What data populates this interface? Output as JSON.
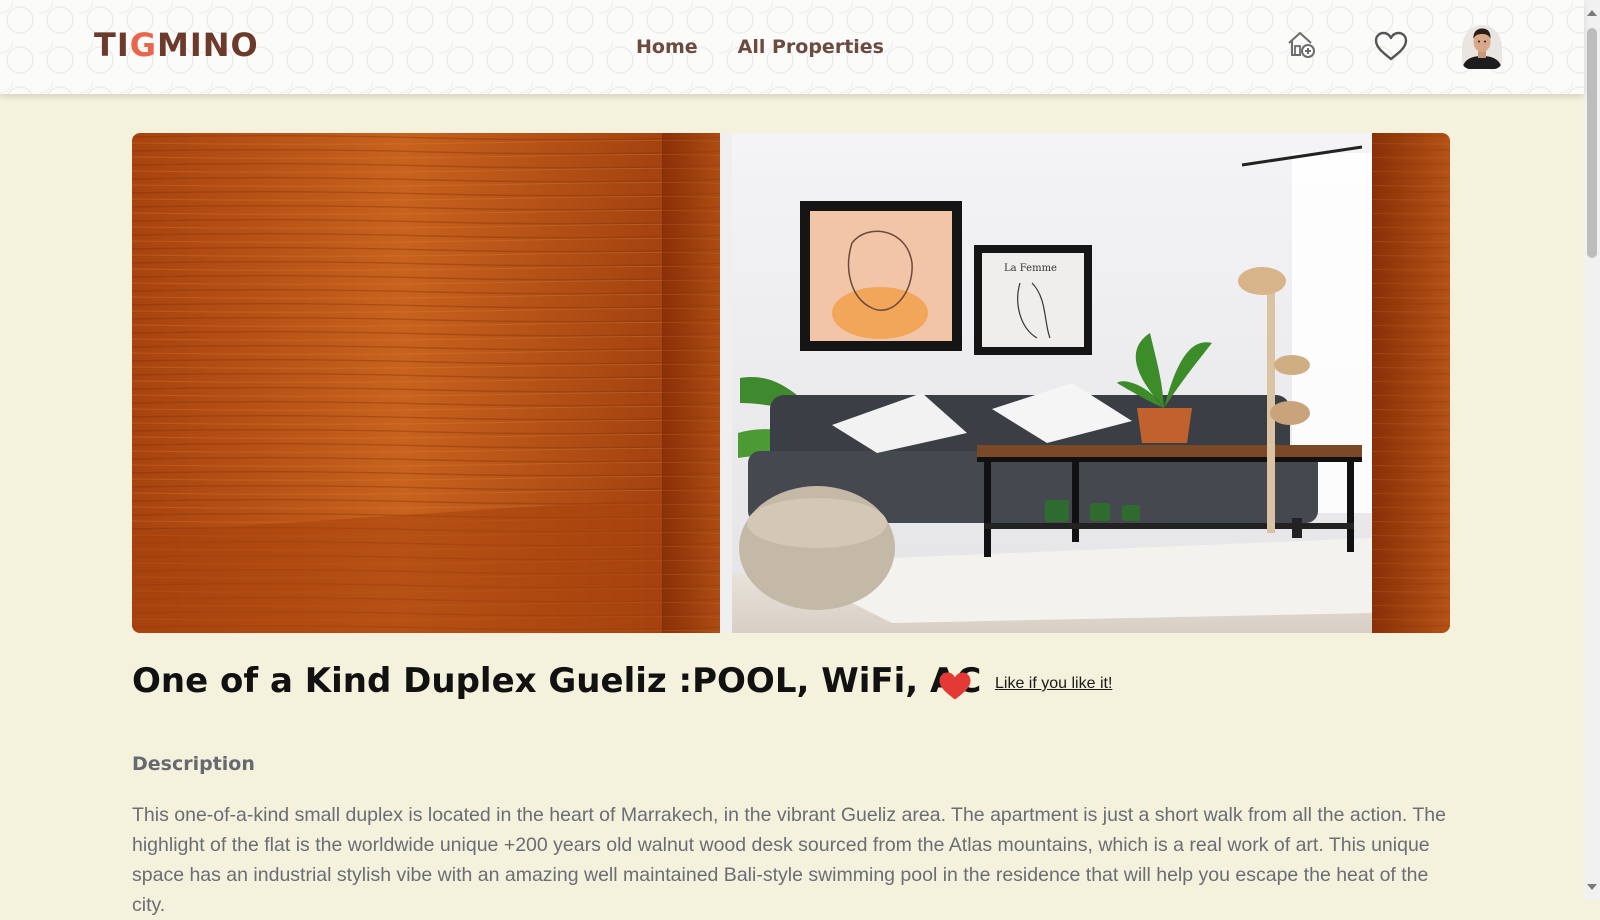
{
  "header": {
    "logo": {
      "part1": "TI",
      "part2": "G",
      "part3": "MINO"
    },
    "nav": [
      {
        "label": "Home"
      },
      {
        "label": "All Properties"
      }
    ],
    "icons": {
      "add_property": "home-plus-icon",
      "favorites": "heart-outline-icon",
      "avatar": "user-avatar"
    }
  },
  "property": {
    "title": "One of a Kind Duplex Gueliz :POOL, WiFi, AC",
    "like_label": "Like if you like it!",
    "liked": true,
    "description_heading": "Description",
    "description": "This one-of-a-kind small duplex is located in the heart of Marrakech, in the vibrant Gueliz area. The apartment is just a short walk from all the action. The highlight of the flat is the worldwide unique +200 years old walnut wood desk sourced from the Atlas mountains, which is a real work of art. This unique space has an industrial stylish vibe with an amazing well maintained Bali-style swimming pool in the residence that will help you escape the heat of the city."
  },
  "colors": {
    "page_background": "#f4f2dc",
    "brand_dark": "#6b3a2a",
    "brand_accent": "#e8674a",
    "heart": "#e53935"
  }
}
